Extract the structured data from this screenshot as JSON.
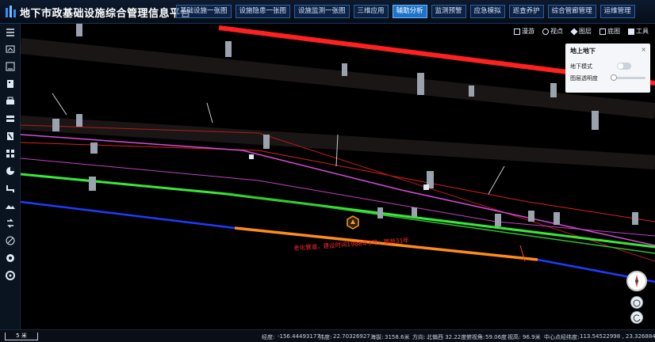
{
  "header": {
    "title": "地下市政基础设施综合管理信息平台",
    "nav": [
      {
        "label": "基础设施一张图",
        "active": false
      },
      {
        "label": "设施隐患一张图",
        "active": false
      },
      {
        "label": "设施监测一张图",
        "active": false
      },
      {
        "label": "三维应用",
        "active": false
      },
      {
        "label": "辅助分析",
        "active": true
      },
      {
        "label": "监测预警",
        "active": false
      },
      {
        "label": "应急模拟",
        "active": false
      },
      {
        "label": "巡查养护",
        "active": false
      },
      {
        "label": "综合管廊管理",
        "active": false
      },
      {
        "label": "运维管理",
        "active": false
      }
    ]
  },
  "right_toolbar": {
    "roam": "漫游",
    "view": "视点",
    "layers": "图层",
    "basemap": "底图",
    "tools": "工具"
  },
  "panel": {
    "title": "地上地下",
    "close": "×",
    "underground_mode_label": "地下模式",
    "underground_mode_on": false,
    "layer_opacity_label": "图层透明度",
    "layer_opacity": 0.05
  },
  "annotation": {
    "text": "老化管道，建设时间1988年3月，管龄31年"
  },
  "status_bar": {
    "scale": "5 米",
    "longitude_label": "经度:",
    "longitude": "-156.44493177",
    "latitude_label": "纬度:",
    "latitude": "22.70326927",
    "altitude_label": "海拔:",
    "altitude": "3158.6米",
    "heading_label": "方向:",
    "heading": "北偏西 32.22度",
    "pitch_label": "俯视角:",
    "pitch": "59.06度",
    "height_label": "视高:",
    "height": "96.9米",
    "center_label": "中心点经纬度:",
    "center": "113.54522998 , 23.32688439"
  },
  "colors": {
    "active_nav": "#1e73c9",
    "pipe_red": "#ff2020",
    "pipe_green": "#39e83a",
    "pipe_magenta": "#d94cd9",
    "pipe_blue": "#1e3cff",
    "pipe_highlight": "#ff8c1a"
  }
}
